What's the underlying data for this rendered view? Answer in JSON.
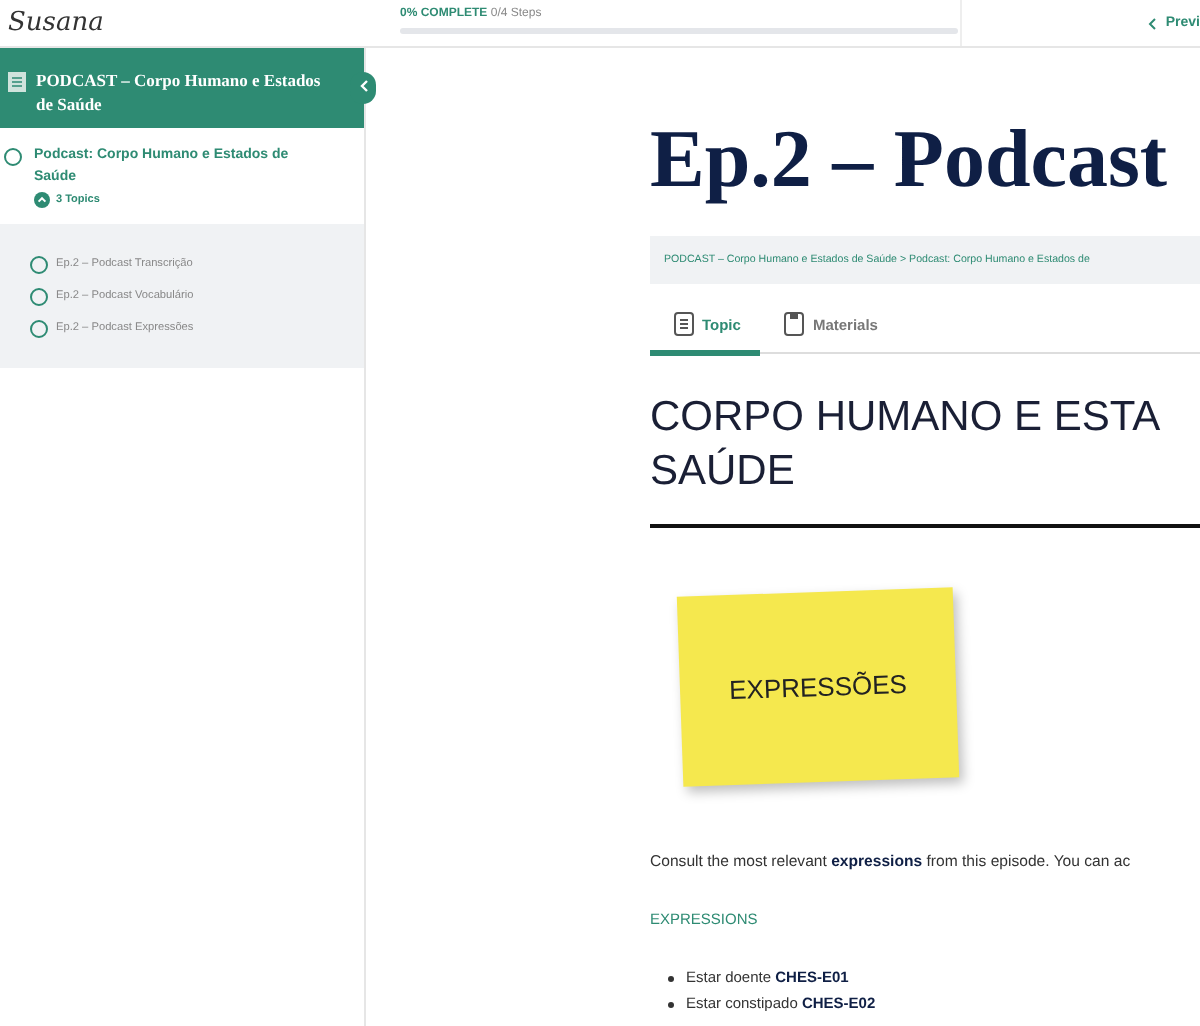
{
  "logo": {
    "text": "Susana"
  },
  "progress": {
    "label": "0% COMPLETE",
    "steps": "0/4 Steps",
    "level": 0
  },
  "nav": {
    "previous": "Previ"
  },
  "sidebar": {
    "course_title": "PODCAST – Corpo Humano e Estados de Saúde",
    "lesson": {
      "title": "Podcast: Corpo Humano e Estados de Saúde",
      "completed": false,
      "topics_label": "3 Topics",
      "expanded": true,
      "topics": [
        {
          "title": "Ep.2 – Podcast Transcrição",
          "completed": false
        },
        {
          "title": "Ep.2 – Podcast Vocabulário",
          "completed": false
        },
        {
          "title": "Ep.2 – Podcast Expressões",
          "completed": false
        }
      ]
    }
  },
  "page_title": "Ep.2 – Podcast",
  "breadcrumb": "PODCAST – Corpo Humano e Estados de Saúde > Podcast: Corpo Humano e Estados de",
  "tabs": [
    {
      "label": "Topic",
      "selected": true
    },
    {
      "label": "Materials",
      "selected": false
    }
  ],
  "heading_lines": [
    "CORPO HUMANO E ESTA",
    "SAÚDE"
  ],
  "sticky_note": "EXPRESSÕES",
  "intro": "Consult the most relevant **expressions** from this episode. You can ac",
  "section_label": "EXPRESSIONS",
  "expressions": [
    {
      "text": "Estar doente",
      "code": "CHES-E01"
    },
    {
      "text": "Estar constipado",
      "code": "CHES-E02"
    }
  ]
}
